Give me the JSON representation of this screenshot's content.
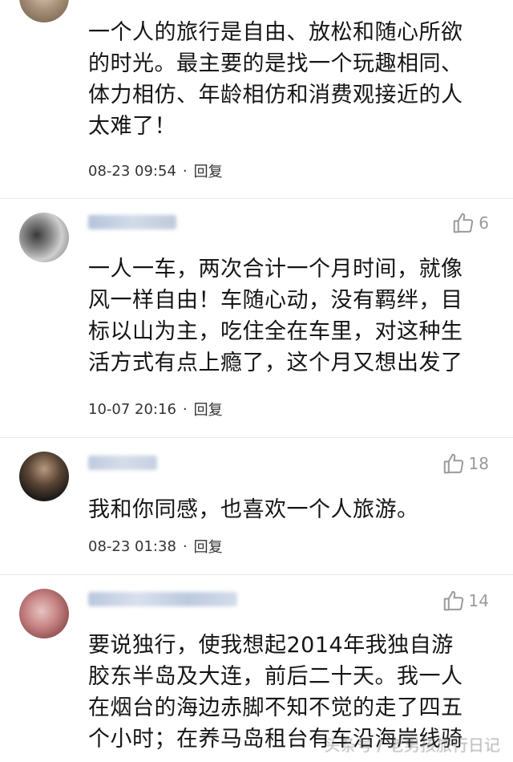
{
  "comments": [
    {
      "likes": "",
      "lines": [
        "一个人的旅行是自由、放松和随心所欲",
        "的时光。最主要的是找一个玩趣相同、",
        "体力相仿、年龄相仿和消费观接近的人",
        "太难了！"
      ],
      "time": "08-23 09:54",
      "separator": "·",
      "reply": "回复"
    },
    {
      "likes": "6",
      "lines": [
        "一人一车，两次合计一个月时间，就像",
        "风一样自由！车随心动，没有羁绊，目",
        "标以山为主，吃住全在车里，对这种生",
        "活方式有点上瘾了，这个月又想出发了"
      ],
      "time": "10-07 20:16",
      "separator": "·",
      "reply": "回复"
    },
    {
      "likes": "18",
      "lines": [
        "我和你同感，也喜欢一个人旅游。"
      ],
      "time": "08-23 01:38",
      "separator": "·",
      "reply": "回复"
    },
    {
      "likes": "14",
      "lines": [
        "要说独行，使我想起2014年我独自游",
        "胶东半岛及大连，前后二十天。我一人",
        "在烟台的海边赤脚不知不觉的走了四五",
        "个小时；在养马岛租台有车沿海岸线骑"
      ],
      "time": "",
      "separator": "",
      "reply": ""
    }
  ],
  "icons": {
    "like": "thumbs-up-icon"
  },
  "colors": {
    "text": "#151515",
    "meta": "#333333",
    "like": "#9a9a9a"
  },
  "watermark": "头条号 / 老男孩旅行日记"
}
